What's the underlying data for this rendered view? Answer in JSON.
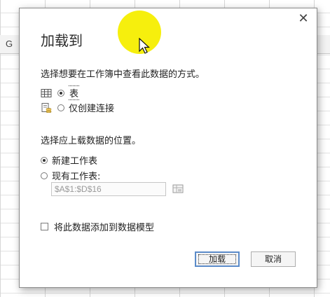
{
  "background": {
    "column_letter": "G"
  },
  "dialog": {
    "title": "加载到",
    "close_glyph": "✕",
    "view_prompt": "选择想要在工作簿中查看此数据的方式。",
    "view_options": [
      {
        "label": "表",
        "icon": "table-icon",
        "checked": true
      },
      {
        "label": "仅创建连接",
        "icon": "connection-icon",
        "checked": false
      }
    ],
    "location_prompt": "选择应上载数据的位置。",
    "location_options": [
      {
        "label": "新建工作表",
        "checked": true
      },
      {
        "label": "现有工作表:",
        "checked": false
      }
    ],
    "range_value": "$A$1:$D$16",
    "data_model_label": "将此数据添加到数据模型",
    "load_button": "加载",
    "cancel_button": "取消"
  },
  "colors": {
    "highlight": "#f5ee00",
    "primary_border": "#5b8bc9"
  }
}
